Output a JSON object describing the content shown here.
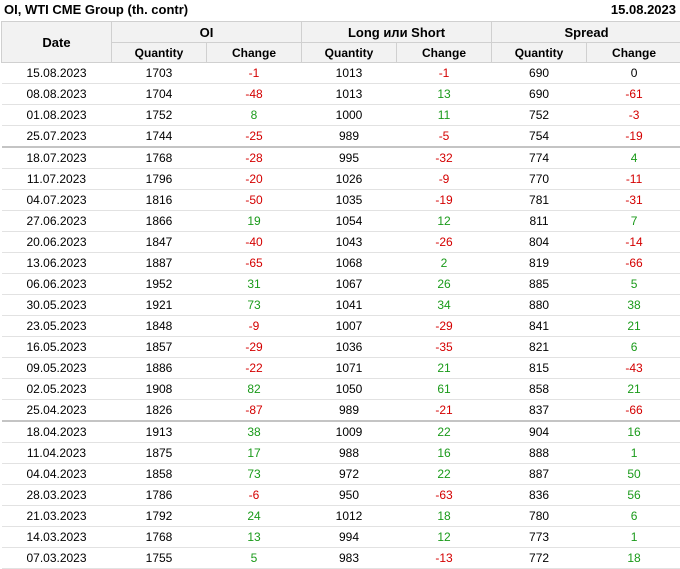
{
  "header": {
    "title": "OI, WTI CME Group (th. contr)",
    "date": "15.08.2023"
  },
  "columns": {
    "date": "Date",
    "groups": [
      "OI",
      "Long или Short",
      "Spread"
    ],
    "quantity": "Quantity",
    "change": "Change"
  },
  "rows": [
    {
      "date": "15.08.2023",
      "oi_q": "1703",
      "oi_c": "-1",
      "ls_q": "1013",
      "ls_c": "-1",
      "sp_q": "690",
      "sp_c": "0",
      "sep": false
    },
    {
      "date": "08.08.2023",
      "oi_q": "1704",
      "oi_c": "-48",
      "ls_q": "1013",
      "ls_c": "13",
      "sp_q": "690",
      "sp_c": "-61",
      "sep": false
    },
    {
      "date": "01.08.2023",
      "oi_q": "1752",
      "oi_c": "8",
      "ls_q": "1000",
      "ls_c": "11",
      "sp_q": "752",
      "sp_c": "-3",
      "sep": false
    },
    {
      "date": "25.07.2023",
      "oi_q": "1744",
      "oi_c": "-25",
      "ls_q": "989",
      "ls_c": "-5",
      "sp_q": "754",
      "sp_c": "-19",
      "sep": false
    },
    {
      "date": "18.07.2023",
      "oi_q": "1768",
      "oi_c": "-28",
      "ls_q": "995",
      "ls_c": "-32",
      "sp_q": "774",
      "sp_c": "4",
      "sep": true
    },
    {
      "date": "11.07.2023",
      "oi_q": "1796",
      "oi_c": "-20",
      "ls_q": "1026",
      "ls_c": "-9",
      "sp_q": "770",
      "sp_c": "-11",
      "sep": false
    },
    {
      "date": "04.07.2023",
      "oi_q": "1816",
      "oi_c": "-50",
      "ls_q": "1035",
      "ls_c": "-19",
      "sp_q": "781",
      "sp_c": "-31",
      "sep": false
    },
    {
      "date": "27.06.2023",
      "oi_q": "1866",
      "oi_c": "19",
      "ls_q": "1054",
      "ls_c": "12",
      "sp_q": "811",
      "sp_c": "7",
      "sep": false
    },
    {
      "date": "20.06.2023",
      "oi_q": "1847",
      "oi_c": "-40",
      "ls_q": "1043",
      "ls_c": "-26",
      "sp_q": "804",
      "sp_c": "-14",
      "sep": false
    },
    {
      "date": "13.06.2023",
      "oi_q": "1887",
      "oi_c": "-65",
      "ls_q": "1068",
      "ls_c": "2",
      "sp_q": "819",
      "sp_c": "-66",
      "sep": false
    },
    {
      "date": "06.06.2023",
      "oi_q": "1952",
      "oi_c": "31",
      "ls_q": "1067",
      "ls_c": "26",
      "sp_q": "885",
      "sp_c": "5",
      "sep": false
    },
    {
      "date": "30.05.2023",
      "oi_q": "1921",
      "oi_c": "73",
      "ls_q": "1041",
      "ls_c": "34",
      "sp_q": "880",
      "sp_c": "38",
      "sep": false
    },
    {
      "date": "23.05.2023",
      "oi_q": "1848",
      "oi_c": "-9",
      "ls_q": "1007",
      "ls_c": "-29",
      "sp_q": "841",
      "sp_c": "21",
      "sep": false
    },
    {
      "date": "16.05.2023",
      "oi_q": "1857",
      "oi_c": "-29",
      "ls_q": "1036",
      "ls_c": "-35",
      "sp_q": "821",
      "sp_c": "6",
      "sep": false
    },
    {
      "date": "09.05.2023",
      "oi_q": "1886",
      "oi_c": "-22",
      "ls_q": "1071",
      "ls_c": "21",
      "sp_q": "815",
      "sp_c": "-43",
      "sep": false
    },
    {
      "date": "02.05.2023",
      "oi_q": "1908",
      "oi_c": "82",
      "ls_q": "1050",
      "ls_c": "61",
      "sp_q": "858",
      "sp_c": "21",
      "sep": false
    },
    {
      "date": "25.04.2023",
      "oi_q": "1826",
      "oi_c": "-87",
      "ls_q": "989",
      "ls_c": "-21",
      "sp_q": "837",
      "sp_c": "-66",
      "sep": false
    },
    {
      "date": "18.04.2023",
      "oi_q": "1913",
      "oi_c": "38",
      "ls_q": "1009",
      "ls_c": "22",
      "sp_q": "904",
      "sp_c": "16",
      "sep": true
    },
    {
      "date": "11.04.2023",
      "oi_q": "1875",
      "oi_c": "17",
      "ls_q": "988",
      "ls_c": "16",
      "sp_q": "888",
      "sp_c": "1",
      "sep": false
    },
    {
      "date": "04.04.2023",
      "oi_q": "1858",
      "oi_c": "73",
      "ls_q": "972",
      "ls_c": "22",
      "sp_q": "887",
      "sp_c": "50",
      "sep": false
    },
    {
      "date": "28.03.2023",
      "oi_q": "1786",
      "oi_c": "-6",
      "ls_q": "950",
      "ls_c": "-63",
      "sp_q": "836",
      "sp_c": "56",
      "sep": false
    },
    {
      "date": "21.03.2023",
      "oi_q": "1792",
      "oi_c": "24",
      "ls_q": "1012",
      "ls_c": "18",
      "sp_q": "780",
      "sp_c": "6",
      "sep": false
    },
    {
      "date": "14.03.2023",
      "oi_q": "1768",
      "oi_c": "13",
      "ls_q": "994",
      "ls_c": "12",
      "sp_q": "773",
      "sp_c": "1",
      "sep": false
    },
    {
      "date": "07.03.2023",
      "oi_q": "1755",
      "oi_c": "5",
      "ls_q": "983",
      "ls_c": "-13",
      "sp_q": "772",
      "sp_c": "18",
      "sep": false
    }
  ],
  "colors": {
    "negative": "#d40000",
    "positive": "#1a9a1a",
    "header_bg": "#f2f2f2"
  }
}
